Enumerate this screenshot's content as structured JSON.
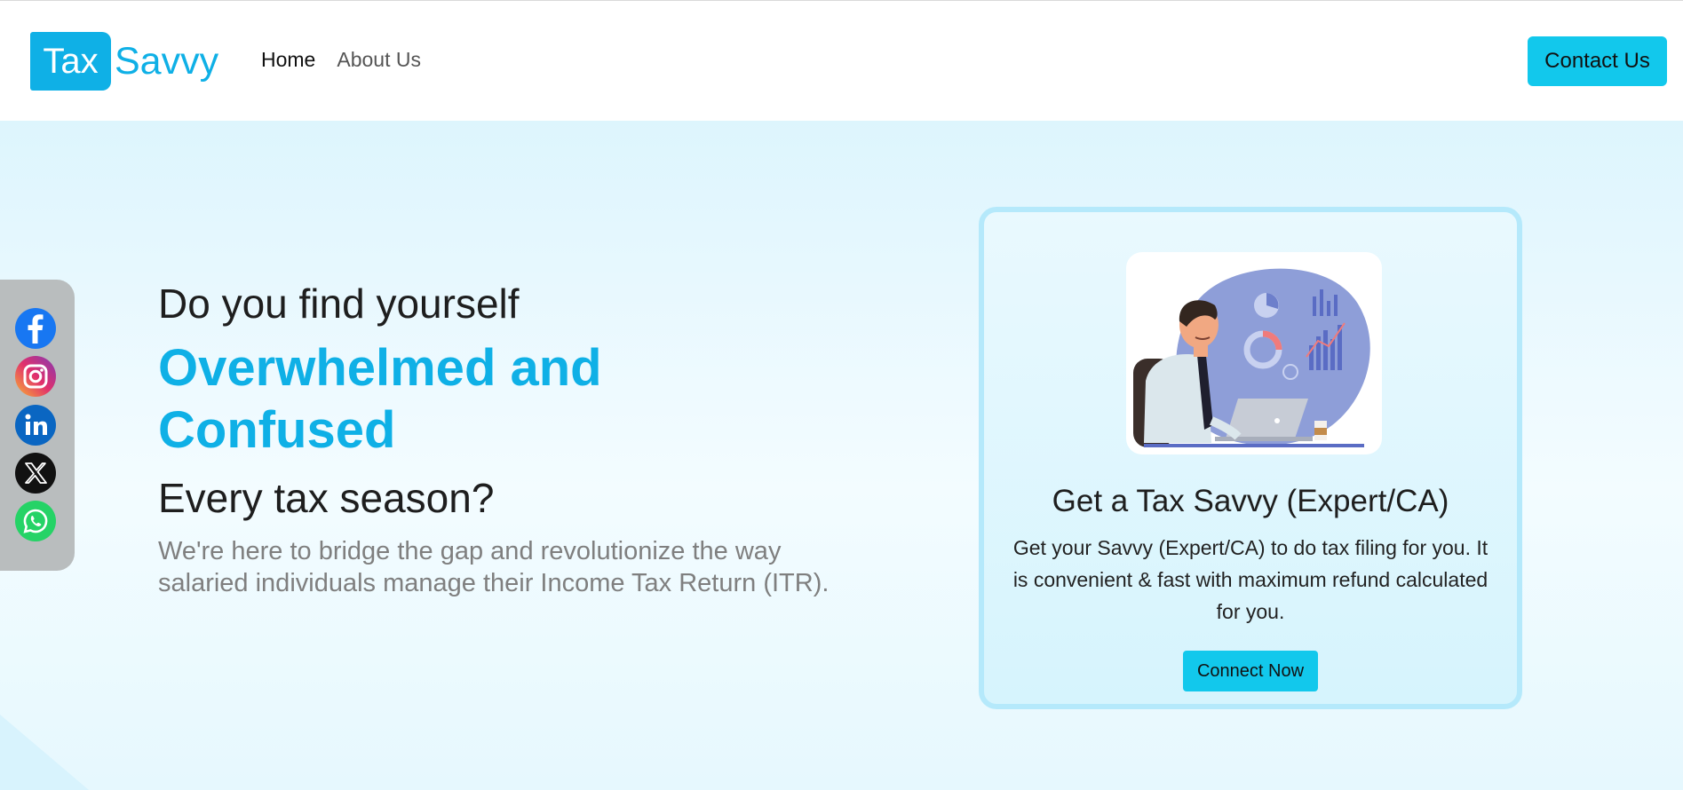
{
  "brand": {
    "logo_box_text": "Tax",
    "logo_text": "Savvy"
  },
  "nav": {
    "items": [
      {
        "label": "Home"
      },
      {
        "label": "About Us"
      }
    ]
  },
  "header": {
    "contact_label": "Contact Us"
  },
  "social": {
    "icons": [
      "facebook-icon",
      "instagram-icon",
      "linkedin-icon",
      "x-twitter-icon",
      "whatsapp-icon"
    ]
  },
  "hero": {
    "line1": "Do you find yourself",
    "highlight": "Overwhelmed and Confused",
    "line3": "Every tax season?",
    "description": "We're here to bridge the gap and revolutionize the way salaried individuals manage their Income Tax Return (ITR)."
  },
  "card": {
    "title": "Get a Tax Savvy (Expert/CA)",
    "text": "Get your Savvy (Expert/CA) to do tax filing for you. It is convenient & fast with maximum refund calculated for you.",
    "button_label": "Connect Now"
  },
  "colors": {
    "brand": "#0fb0e6",
    "button": "#12c8ec",
    "hero_bg": "#e6f8fe",
    "card_border": "#b5e9fb"
  }
}
